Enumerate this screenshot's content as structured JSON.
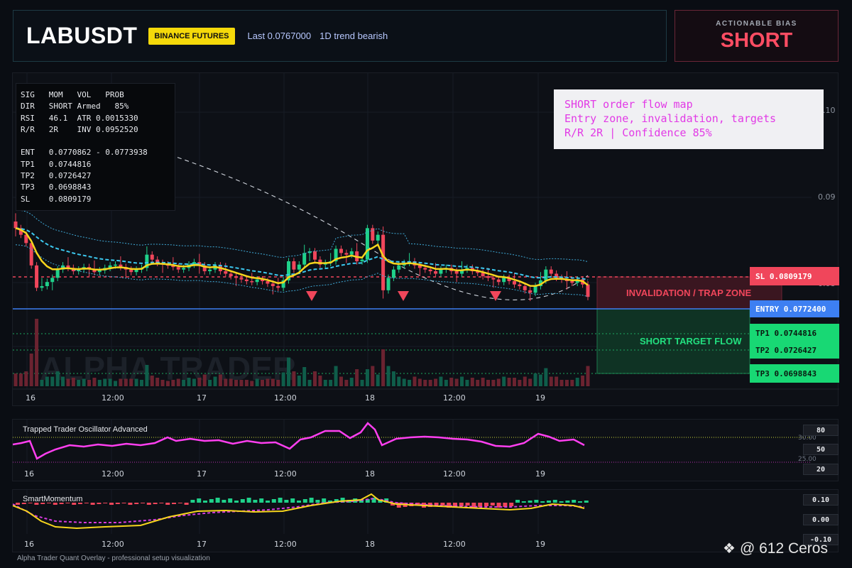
{
  "header": {
    "symbol": "LABUSDT",
    "exchange": "BINANCE FUTURES",
    "last_price": "Last 0.0767000",
    "trend": "1D trend bearish"
  },
  "bias": {
    "label": "ACTIONABLE BIAS",
    "value": "SHORT"
  },
  "info_box": {
    "text": "SIG   MOM   VOL   PROB\nDIR   SHORT Armed   85%\nRSI   46.1  ATR 0.0015330\nR/R   2R    INV 0.0952520\n\nENT   0.0770862 - 0.0773938\nTP1   0.0744816\nTP2   0.0726427\nTP3   0.0698843\nSL    0.0809179"
  },
  "note": {
    "line1": "SHORT order flow map",
    "line2": "Entry zone, invalidation, targets",
    "line3": "R/R 2R | Confidence 85%"
  },
  "levels": {
    "sl": "SL 0.0809179",
    "entry": "ENTRY 0.0772400",
    "tp1": "TP1 0.0744816",
    "tp2": "TP2 0.0726427",
    "tp3": "TP3 0.0698843"
  },
  "zones": {
    "invalidation": "INVALIDATION / TRAP ZONE",
    "target": "SHORT TARGET FLOW"
  },
  "price_axis": {
    "top": "0.10",
    "mid": "0.09",
    "low": "0.08"
  },
  "time_axis": [
    "16",
    "12:00",
    "17",
    "12:00",
    "18",
    "12:00",
    "19"
  ],
  "watermark_text": "ALPHA TRADER",
  "oscillator": {
    "title": "Trapped Trader Oscillator Advanced",
    "scale": [
      "80",
      "50",
      "20"
    ],
    "levels_text": [
      "30.00",
      "25.00"
    ]
  },
  "momentum": {
    "title": "SmartMomentum",
    "scale": [
      "0.10",
      "0.00",
      "-0.10"
    ]
  },
  "footer": "Alpha Trader Quant Overlay - professional setup visualization",
  "brand": "@ 612 Ceros",
  "colors": {
    "up": "#1fd18a",
    "down": "#f0465b",
    "ema": "#f7d51d",
    "entry": "#3d7ff2",
    "sl": "#f0465b",
    "tp": "#18d874",
    "osc": "#ff3ff0"
  },
  "chart_data": {
    "type": "candlestick",
    "y_range": [
      0.066,
      0.102
    ],
    "x_labels": [
      "16",
      "12:00",
      "17",
      "12:00",
      "18",
      "12:00",
      "19"
    ],
    "closes": [
      0.085,
      0.0842,
      0.0832,
      0.0805,
      0.0778,
      0.078,
      0.0785,
      0.079,
      0.08,
      0.0805,
      0.0802,
      0.0798,
      0.08,
      0.0803,
      0.0801,
      0.0797,
      0.0799,
      0.0802,
      0.0805,
      0.0806,
      0.0803,
      0.08,
      0.0797,
      0.08,
      0.0802,
      0.0818,
      0.0812,
      0.0808,
      0.0806,
      0.0805,
      0.0803,
      0.08,
      0.0802,
      0.0806,
      0.0809,
      0.0805,
      0.0798,
      0.08,
      0.0805,
      0.0798,
      0.0795,
      0.0792,
      0.079,
      0.0788,
      0.0786,
      0.0785,
      0.0788,
      0.0786,
      0.0783,
      0.078,
      0.0778,
      0.0787,
      0.081,
      0.08,
      0.0806,
      0.082,
      0.0822,
      0.0812,
      0.0806,
      0.0808,
      0.081,
      0.0825,
      0.082,
      0.0818,
      0.0822,
      0.081,
      0.0812,
      0.085,
      0.0835,
      0.0842,
      0.0775,
      0.079,
      0.08,
      0.0805,
      0.0808,
      0.081,
      0.0805,
      0.0802,
      0.08,
      0.0798,
      0.0795,
      0.08,
      0.0802,
      0.0798,
      0.0795,
      0.08,
      0.0802,
      0.0798,
      0.0796,
      0.0792,
      0.079,
      0.0788,
      0.0785,
      0.079,
      0.0786,
      0.0782,
      0.078,
      0.0775,
      0.0772,
      0.078,
      0.0787,
      0.08,
      0.0795,
      0.079,
      0.0788,
      0.0786,
      0.0784,
      0.0788,
      0.0782,
      0.0767
    ]
  }
}
